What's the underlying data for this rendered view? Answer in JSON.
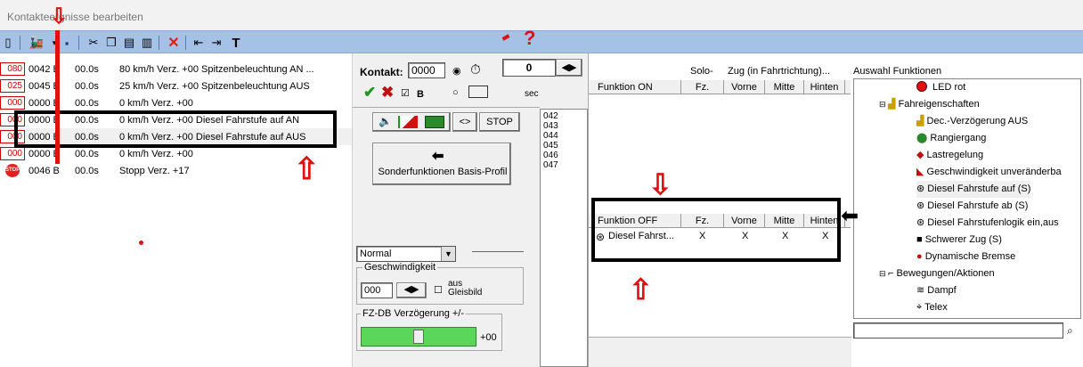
{
  "window": {
    "title": "Kontakte"
  },
  "events": [
    {
      "icon": "080",
      "id": "0042 B",
      "time": "00.0s",
      "desc": "80 km/h Verz. +00 Spitzenbeleuchtung AN ..."
    },
    {
      "icon": "025",
      "id": "0045 B",
      "time": "00.0s",
      "desc": "25 km/h Verz. +00 Spitzenbeleuchtung AUS"
    },
    {
      "icon": "000",
      "id": "0000 B",
      "time": "00.0s",
      "desc": "0 km/h Verz. +00"
    },
    {
      "icon": "000",
      "id": "0000 B",
      "time": "00.0s",
      "desc": "0 km/h Verz. +00 Diesel Fahrstufe auf AN"
    },
    {
      "icon": "000",
      "id": "0000 B",
      "time": "00.0s",
      "desc": "0 km/h Verz. +00 Diesel Fahrstufe auf AUS"
    },
    {
      "icon": "000",
      "id": "0000 B",
      "time": "00.0s",
      "desc": "0 km/h Verz. +00"
    },
    {
      "icon": "STOP",
      "id": "0046 B",
      "time": "00.0s",
      "desc": "Stopp Verz. +17"
    }
  ],
  "contact": {
    "label": "Kontakt:",
    "value": "0000",
    "counter": "0",
    "b_label": "B",
    "sec_label": "sec"
  },
  "buttons": {
    "stop": "STOP",
    "arrows": "<>",
    "sonder": "Sonderfunktionen Basis-Profil"
  },
  "numbers": [
    "042",
    "043",
    "044",
    "045",
    "046",
    "047"
  ],
  "mode": {
    "selected": "Normal"
  },
  "speed": {
    "group": "Geschwindigkeit",
    "value": "000",
    "aus_label": "aus",
    "gleis_label": "Gleisbild"
  },
  "fzdb": {
    "label": "FZ-DB Verzögerung +/-",
    "value": "+00"
  },
  "table_top": {
    "group1": "Solo-",
    "group2": "Zug (in Fahrtrichtung)...",
    "cols": [
      "Funktion ON",
      "Fz.",
      "Vorne",
      "Mitte",
      "Hinten"
    ]
  },
  "table_bottom": {
    "cols": [
      "Funktion OFF",
      "Fz.",
      "Vorne",
      "Mitte",
      "Hinten"
    ],
    "row": {
      "name": "Diesel Fahrst...",
      "fz": "X",
      "vorne": "X",
      "mitte": "X",
      "hinten": "X"
    }
  },
  "tree": {
    "header": "Auswahl Funktionen",
    "items": [
      {
        "label": "LED rot",
        "icon": "red-dot-icon"
      },
      {
        "label": "Fahreigenschaften",
        "icon": "folder-stairs-icon"
      },
      {
        "label": "Dec.-Verzögerung AUS",
        "icon": "stairs-icon"
      },
      {
        "label": "Rangiergang",
        "icon": "shunting-icon"
      },
      {
        "label": "Lastregelung",
        "icon": "load-icon"
      },
      {
        "label": "Geschwindigkeit unveränderba",
        "icon": "speed-icon"
      },
      {
        "label": "Diesel Fahrstufe auf (S)",
        "icon": "diesel-up-icon"
      },
      {
        "label": "Diesel Fahrstufe ab (S)",
        "icon": "diesel-down-icon"
      },
      {
        "label": "Diesel Fahrstufenlogik ein,aus",
        "icon": "diesel-logic-icon"
      },
      {
        "label": "Schwerer Zug (S)",
        "icon": "heavy-train-icon"
      },
      {
        "label": "Dynamische Bremse",
        "icon": "brake-icon"
      },
      {
        "label": "Bewegungen/Aktionen",
        "icon": "folder-actions-icon"
      },
      {
        "label": "Dampf",
        "icon": "steam-icon"
      },
      {
        "label": "Telex",
        "icon": "telex-icon"
      }
    ]
  },
  "annotation": {
    "question": "?"
  },
  "colors": {
    "toolbar": "#a5c2e6",
    "annotation_red": "#e01010",
    "slider_green": "#5ad65a"
  }
}
